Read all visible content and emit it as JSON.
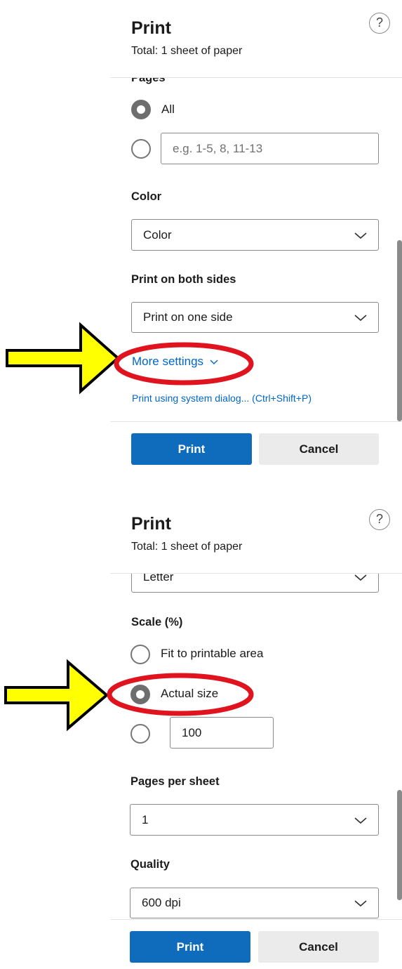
{
  "panel1": {
    "title": "Print",
    "subtitle": "Total: 1 sheet of paper",
    "help_label": "?",
    "pages_label": "Pages",
    "radio_all_label": "All",
    "pages_placeholder": "e.g. 1-5, 8, 11-13",
    "color_label": "Color",
    "color_value": "Color",
    "duplex_label": "Print on both sides",
    "duplex_value": "Print on one side",
    "more_settings": "More settings",
    "system_dialog": "Print using system dialog... (Ctrl+Shift+P)",
    "print_button": "Print",
    "cancel_button": "Cancel"
  },
  "panel2": {
    "title": "Print",
    "subtitle": "Total: 1 sheet of paper",
    "help_label": "?",
    "paper_value": "Letter",
    "scale_label": "Scale (%)",
    "fit_label": "Fit to printable area",
    "actual_label": "Actual size",
    "custom_value": "100",
    "pps_label": "Pages per sheet",
    "pps_value": "1",
    "quality_label": "Quality",
    "quality_value": "600 dpi",
    "print_button": "Print",
    "cancel_button": "Cancel"
  },
  "colors": {
    "accent": "#0f6cbd",
    "annotation_red": "#e0141e",
    "annotation_yellow": "#ffff00"
  }
}
